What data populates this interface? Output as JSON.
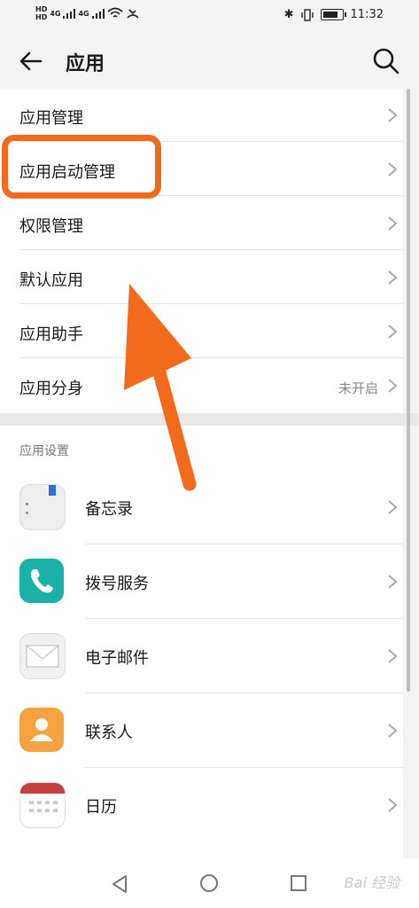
{
  "status_bar": {
    "net1": "HD",
    "net2": "HD",
    "sig1": "4G",
    "sig2": "4G",
    "time": "11:32"
  },
  "header": {
    "title": "应用",
    "back_icon": "arrow-left-icon",
    "search_icon": "search-icon"
  },
  "menu": [
    {
      "label": "应用管理"
    },
    {
      "label": "应用启动管理"
    },
    {
      "label": "权限管理"
    },
    {
      "label": "默认应用"
    },
    {
      "label": "应用助手"
    },
    {
      "label": "应用分身",
      "status": "未开启"
    }
  ],
  "app_settings": {
    "section_title": "应用设置",
    "apps": [
      {
        "label": "备忘录",
        "icon": "notes-icon"
      },
      {
        "label": "拨号服务",
        "icon": "phone-icon"
      },
      {
        "label": "电子邮件",
        "icon": "email-icon"
      },
      {
        "label": "联系人",
        "icon": "contacts-icon"
      },
      {
        "label": "日历",
        "icon": "calendar-icon"
      }
    ]
  },
  "nav": {
    "watermark": "Bai 经验"
  },
  "colors": {
    "accent": "#f26a1b",
    "phone": "#1ab1a8",
    "contacts": "#f5a340",
    "calendar": "#c73e3e"
  }
}
